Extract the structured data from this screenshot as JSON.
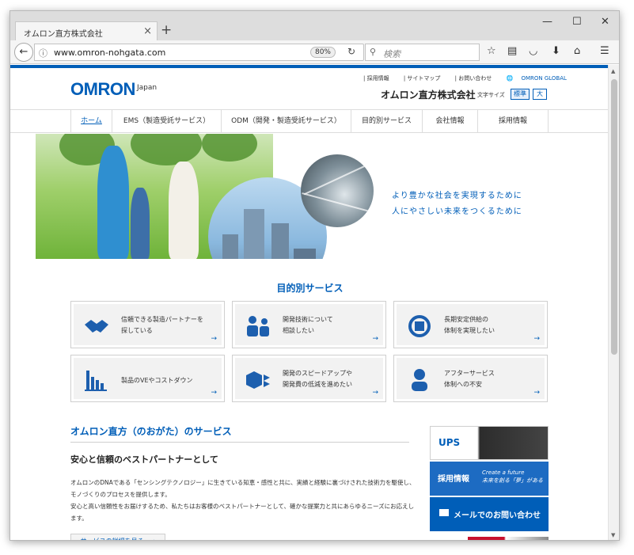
{
  "browser": {
    "tab_title": "オムロン直方株式会社",
    "tab_close": "×",
    "new_tab": "+",
    "win_min": "—",
    "win_max": "☐",
    "win_close": "✕",
    "url": "www.omron-nohgata.com",
    "zoom": "80%",
    "search_placeholder": "検索"
  },
  "header": {
    "logo": "OMRON",
    "logo_sub": "Japan",
    "utility_links": [
      "採用情報",
      "サイトマップ",
      "お問い合わせ"
    ],
    "global_link": "OMRON GLOBAL",
    "company_name": "オムロン直方株式会社",
    "font_size_label": "文字サイズ",
    "font_size_normal": "標準",
    "font_size_large": "大"
  },
  "nav": {
    "items": [
      "ホーム",
      "EMS（製造受託サービス）",
      "ODM（開発・製造受託サービス）",
      "目的別サービス",
      "会社情報",
      "採用情報"
    ]
  },
  "hero": {
    "line1": "より豊かな社会を実現するために",
    "line2": "人にやさしい未来をつくるために"
  },
  "purpose": {
    "title": "目的別サービス",
    "cards": [
      {
        "icon": "handshake-icon",
        "line1": "信頼できる製造パートナーを",
        "line2": "探している"
      },
      {
        "icon": "consultation-icon",
        "line1": "開発技術について",
        "line2": "相談したい"
      },
      {
        "icon": "cycle-icon",
        "line1": "長期安定供給の",
        "line2": "体制を実現したい"
      },
      {
        "icon": "cost-chart-icon",
        "line1": "製品のVEやコストダウン",
        "line2": ""
      },
      {
        "icon": "speed-cubes-icon",
        "line1": "開発のスピードアップや",
        "line2": "開発費の低減を進めたい"
      },
      {
        "icon": "support-person-icon",
        "line1": "アフターサービス",
        "line2": "体制への不安"
      }
    ],
    "arrow": "→"
  },
  "services": {
    "title": "オムロン直方（のおがた）のサービス",
    "subtitle": "安心と信頼のベストパートナーとして",
    "para1": "オムロンのDNAである「センシングテクノロジー」に生きている知恵・感性と共に、実績と経験に裏づけされた技術力を駆使し、モノづくりのプロセスを提供します。",
    "para2": "安心と高い信頼性をお届けするため、私たちはお客様のベストパートナーとして、確かな提案力と共にあらゆるニーズにお応えします。",
    "link": "サービスの詳細を見る　→"
  },
  "sidebar": {
    "ups": "UPS",
    "recruit": "採用情報",
    "recruit_sub1": "Create a future",
    "recruit_sub2": "未来を創る「夢」がある",
    "contact": "メールでのお問い合わせ"
  },
  "colors": {
    "brand_blue": "#005eb8",
    "accent_red": "#c8102e"
  }
}
